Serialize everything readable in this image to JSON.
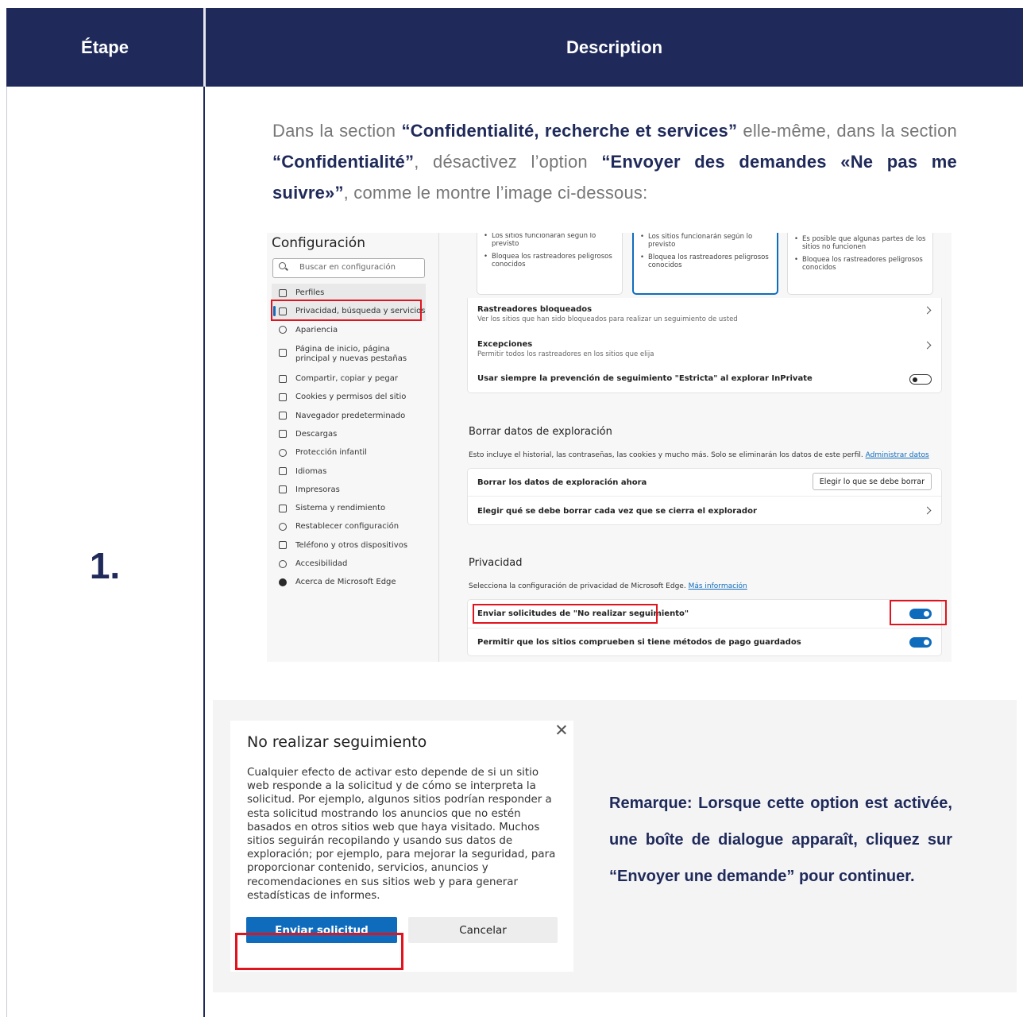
{
  "table": {
    "header_step": "Étape",
    "header_description": "Description",
    "step_number": "1."
  },
  "intro": {
    "t1": "Dans la section ",
    "b1": "“Confidentialité, recherche et services”",
    "t2": " elle-même, dans la section ",
    "b2": "“Confidentialité”",
    "t3": ", désactivez l’option ",
    "b3": "“Envoyer des demandes «Ne pas me suivre»”",
    "t4": ", comme le montre l’image ci-dessous:"
  },
  "settings": {
    "title": "Configuración",
    "search_placeholder": "Buscar en configuración",
    "nav": [
      {
        "label": "Perfiles",
        "icon": "profile-icon"
      },
      {
        "label": "Privacidad, búsqueda y servicios",
        "icon": "lock-icon"
      },
      {
        "label": "Apariencia",
        "icon": "palette-icon"
      },
      {
        "label": "Página de inicio, página principal y nuevas pestañas",
        "icon": "home-page-icon"
      },
      {
        "label": "Compartir, copiar y pegar",
        "icon": "share-icon"
      },
      {
        "label": "Cookies y permisos del sitio",
        "icon": "cookie-icon"
      },
      {
        "label": "Navegador predeterminado",
        "icon": "browser-icon"
      },
      {
        "label": "Descargas",
        "icon": "download-icon"
      },
      {
        "label": "Protección infantil",
        "icon": "family-icon"
      },
      {
        "label": "Idiomas",
        "icon": "language-icon"
      },
      {
        "label": "Impresoras",
        "icon": "printer-icon"
      },
      {
        "label": "Sistema y rendimiento",
        "icon": "laptop-icon"
      },
      {
        "label": "Restablecer configuración",
        "icon": "reset-icon"
      },
      {
        "label": "Teléfono y otros dispositivos",
        "icon": "phone-icon"
      },
      {
        "label": "Accesibilidad",
        "icon": "accessibility-icon"
      },
      {
        "label": "Acerca de Microsoft Edge",
        "icon": "edge-icon"
      }
    ],
    "cards": [
      {
        "items": [
          "Los sitios funcionarán según lo previsto",
          "Bloquea los rastreadores peligrosos conocidos"
        ]
      },
      {
        "items": [
          "Los sitios funcionarán según lo previsto",
          "Bloquea los rastreadores peligrosos conocidos"
        ]
      },
      {
        "items": [
          "Es posible que algunas partes de los sitios no funcionen",
          "Bloquea los rastreadores peligrosos conocidos"
        ]
      }
    ],
    "tracking": {
      "blocked_title": "Rastreadores bloqueados",
      "blocked_sub": "Ver los sitios que han sido bloqueados para realizar un seguimiento de usted",
      "exceptions_title": "Excepciones",
      "exceptions_sub": "Permitir todos los rastreadores en los sitios que elija",
      "strict_label": "Usar siempre la prevención de seguimiento \"Estricta\" al explorar InPrivate"
    },
    "clear": {
      "title": "Borrar datos de exploración",
      "desc": "Esto incluye el historial, las contraseñas, las cookies y mucho más. Solo se eliminarán los datos de este perfil.",
      "desc_link": "Administrar datos",
      "now_label": "Borrar los datos de exploración ahora",
      "now_button": "Elegir lo que se debe borrar",
      "choose_label": "Elegir qué se debe borrar cada vez que se cierra el explorador"
    },
    "privacy": {
      "title": "Privacidad",
      "desc": "Selecciona la configuración de privacidad de Microsoft Edge.",
      "desc_link": "Más información",
      "dnt_label": "Enviar solicitudes de \"No realizar seguimiento\"",
      "payment_label": "Permitir que los sitios comprueben si tiene métodos de pago guardados"
    }
  },
  "dialog": {
    "title": "No realizar seguimiento",
    "body": "Cualquier efecto de activar esto depende de si un sitio web responde a la solicitud y de cómo se interpreta la solicitud. Por ejemplo, algunos sitios podrían responder a esta solicitud mostrando los anuncios que no estén basados en otros sitios web que haya visitado. Muchos sitios seguirán recopilando y usando sus datos de exploración; por ejemplo, para mejorar la seguridad, para proporcionar contenido, servicios, anuncios y recomendaciones en sus sitios web y para generar estadísticas de informes.",
    "ok_label": "Enviar solicitud",
    "cancel_label": "Cancelar"
  },
  "remark": "Remarque: Lorsque cette option est activée, une boîte de dialogue apparaît, cliquez sur “Envoyer une demande” pour continuer.",
  "colors": {
    "header_bg": "#1f2a5a",
    "accent_blue": "#0f6cbd",
    "highlight_red": "#e0141e"
  }
}
